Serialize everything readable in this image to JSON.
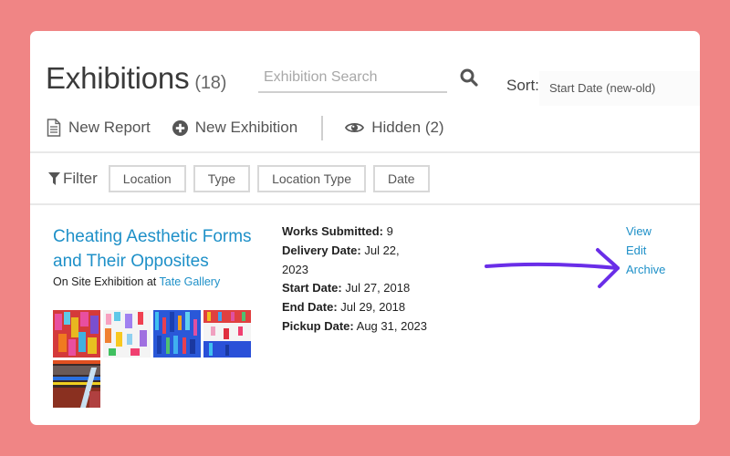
{
  "header": {
    "title": "Exhibitions",
    "count": "(18)",
    "search": {
      "placeholder": "Exhibition Search",
      "value": ""
    },
    "sort_label": "Sort:",
    "sort_value": "Start Date (new-old)"
  },
  "toolbar": {
    "new_report": "New Report",
    "new_exhibition": "New Exhibition",
    "hidden": "Hidden (2)"
  },
  "filter": {
    "label": "Filter",
    "buttons": [
      "Location",
      "Type",
      "Location Type",
      "Date"
    ]
  },
  "exhibition": {
    "title": "Cheating Aesthetic Forms and Their Opposites",
    "subtitle_prefix": "On Site Exhibition at",
    "location": "Tate Gallery",
    "details": [
      {
        "label": "Works Submitted:",
        "value": "9"
      },
      {
        "label": "Delivery Date:",
        "value": "Jul 22, 2023"
      },
      {
        "label": "Start Date:",
        "value": "Jul 27, 2018"
      },
      {
        "label": "End Date:",
        "value": "Jul 29, 2018"
      },
      {
        "label": "Pickup Date:",
        "value": "Aug 31, 2023"
      }
    ],
    "actions": [
      "View",
      "Edit",
      "Archive"
    ],
    "thumbnails": [
      {
        "name": "artwork-1",
        "palette": "warm-multicolor"
      },
      {
        "name": "artwork-2",
        "palette": "white-pastel"
      },
      {
        "name": "artwork-3",
        "palette": "blue-multicolor"
      },
      {
        "name": "artwork-4",
        "palette": "white-red-blue"
      },
      {
        "name": "artwork-5",
        "palette": "dark-abstract"
      }
    ]
  },
  "colors": {
    "background": "#f08585",
    "link": "#1e90c8",
    "annotation_arrow": "#6a2ee8"
  }
}
